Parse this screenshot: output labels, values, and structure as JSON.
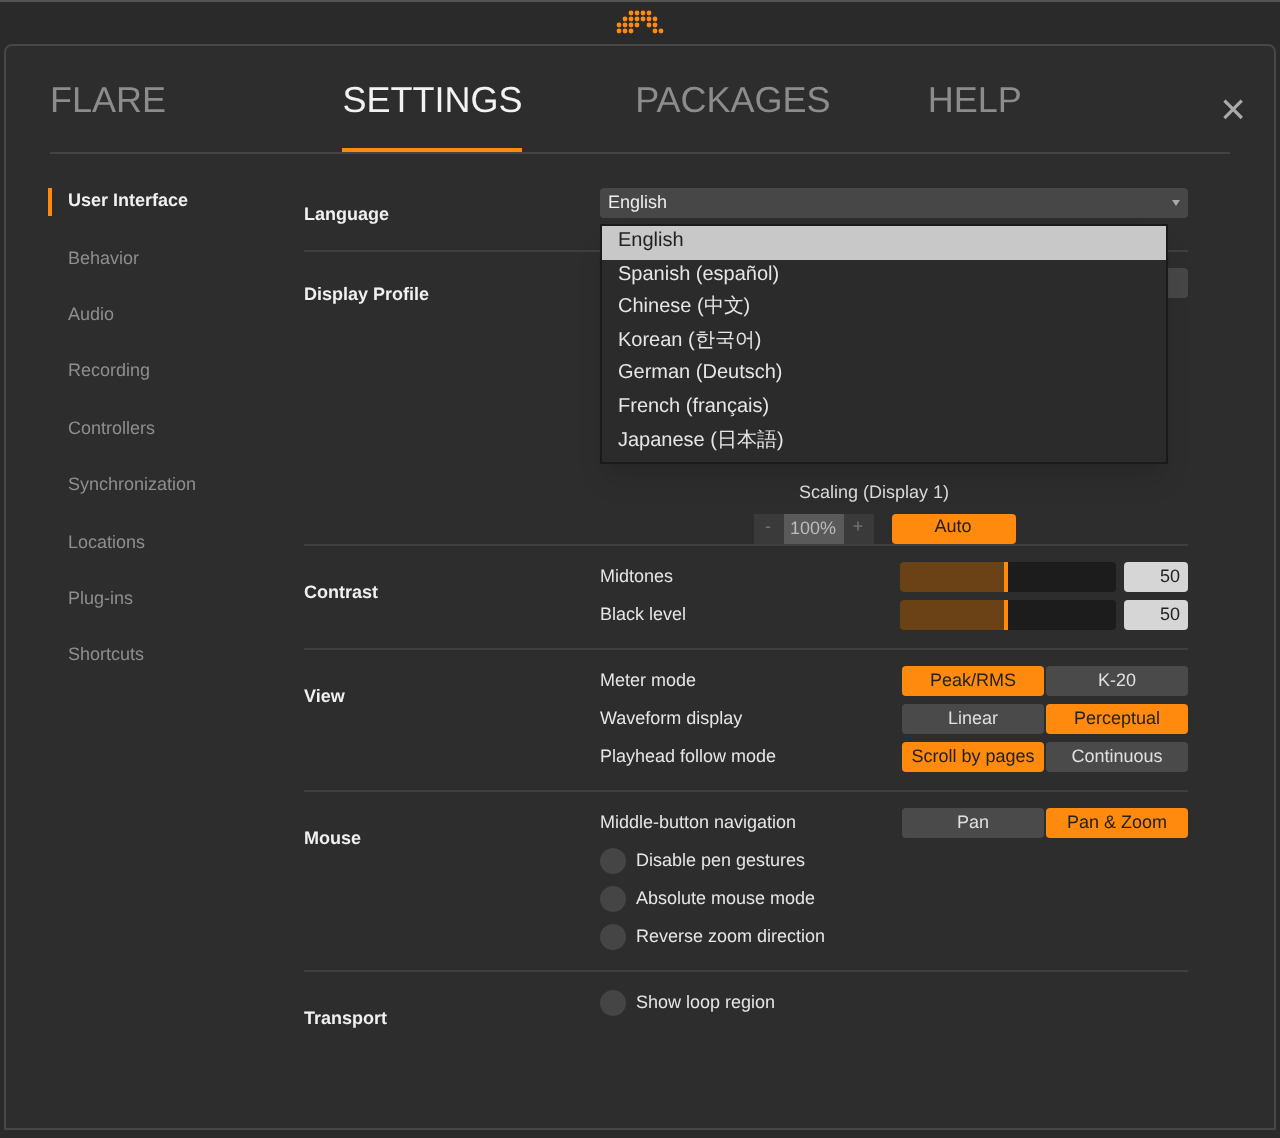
{
  "tabs": [
    {
      "label": "FLARE",
      "selected": false
    },
    {
      "label": "SETTINGS",
      "selected": true
    },
    {
      "label": "PACKAGES",
      "selected": false
    },
    {
      "label": "HELP",
      "selected": false
    }
  ],
  "close": "×",
  "sidebar": {
    "items": [
      {
        "label": "User Interface",
        "selected": true
      },
      {
        "label": "Behavior",
        "selected": false
      },
      {
        "label": "Audio",
        "selected": false
      },
      {
        "label": "Recording",
        "selected": false
      },
      {
        "label": "Controllers",
        "selected": false
      },
      {
        "label": "Synchronization",
        "selected": false
      },
      {
        "label": "Locations",
        "selected": false
      },
      {
        "label": "Plug-ins",
        "selected": false
      },
      {
        "label": "Shortcuts",
        "selected": false
      }
    ]
  },
  "language": {
    "label": "Language",
    "value": "English",
    "options": [
      {
        "label": "English",
        "selected": true
      },
      {
        "label": "Spanish (español)",
        "selected": false
      },
      {
        "label": "Chinese (中文)",
        "selected": false
      },
      {
        "label": "Korean (한국어)",
        "selected": false
      },
      {
        "label": "German (Deutsch)",
        "selected": false
      },
      {
        "label": "French (français)",
        "selected": false
      },
      {
        "label": "Japanese (日本語)",
        "selected": false
      }
    ]
  },
  "display_profile": {
    "label": "Display Profile",
    "scaling_label": "Scaling (Display 1)",
    "minus": "-",
    "scale": "100%",
    "plus": "+",
    "auto": "Auto"
  },
  "sections": [
    {
      "label": "Contrast",
      "rows": [
        {
          "kind": "slider",
          "label": "Midtones",
          "level": 0.5,
          "value": "50"
        },
        {
          "kind": "slider",
          "label": "Black level",
          "level": 0.5,
          "value": "50"
        }
      ]
    },
    {
      "label": "View",
      "rows": [
        {
          "kind": "segmented",
          "label": "Meter mode",
          "options": [
            {
              "label": "Peak/RMS",
              "selected": true
            },
            {
              "label": "K-20",
              "selected": false
            }
          ]
        },
        {
          "kind": "segmented",
          "label": "Waveform display",
          "options": [
            {
              "label": "Linear",
              "selected": false
            },
            {
              "label": "Perceptual",
              "selected": true
            }
          ]
        },
        {
          "kind": "segmented",
          "label": "Playhead follow mode",
          "options": [
            {
              "label": "Scroll by pages",
              "selected": true
            },
            {
              "label": "Continuous",
              "selected": false
            }
          ]
        }
      ]
    },
    {
      "label": "Mouse",
      "rows": [
        {
          "kind": "segmented",
          "label": "Middle-button navigation",
          "options": [
            {
              "label": "Pan",
              "selected": false
            },
            {
              "label": "Pan & Zoom",
              "selected": true
            }
          ]
        },
        {
          "kind": "toggle",
          "label": "Disable pen gestures",
          "checked": false
        },
        {
          "kind": "toggle",
          "label": "Absolute mouse mode",
          "checked": false
        },
        {
          "kind": "toggle",
          "label": "Reverse zoom direction",
          "checked": false
        }
      ]
    },
    {
      "label": "Transport",
      "rows": [
        {
          "kind": "toggle",
          "label": "Show loop region",
          "checked": false
        }
      ]
    }
  ]
}
